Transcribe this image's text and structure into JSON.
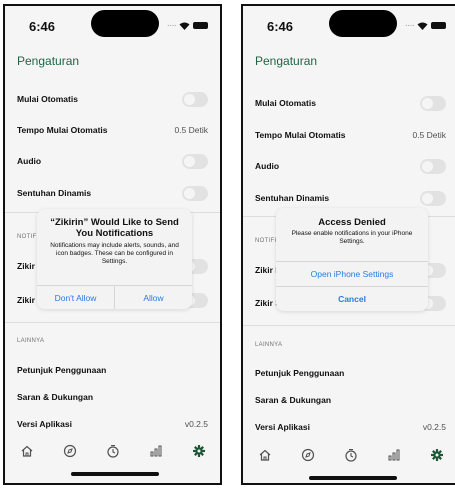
{
  "status_bar": {
    "time": "6:46"
  },
  "screen": {
    "title": "Pengaturan",
    "rows": {
      "auto_start": {
        "label": "Mulai Otomatis"
      },
      "auto_tempo": {
        "label": "Tempo Mulai Otomatis",
        "value": "0.5 Detik"
      },
      "audio": {
        "label": "Audio"
      },
      "haptics": {
        "label": "Sentuhan Dinamis"
      },
      "notif_row1": {
        "label": "Zikir P"
      },
      "notif_row2": {
        "label": "Zikir S"
      },
      "guide": {
        "label": "Petunjuk Penggunaan"
      },
      "support": {
        "label": "Saran & Dukungan"
      },
      "version": {
        "label": "Versi Aplikasi",
        "value": "v0.2.5"
      }
    },
    "sections": {
      "notifications": "NOTIFI",
      "others": "LAINNYA"
    },
    "tabs": [
      "home-icon",
      "compass-icon",
      "timer-icon",
      "stats-icon",
      "gear-icon"
    ]
  },
  "permission_dialog": {
    "title": "“Zikirin” Would Like to Send You Notifications",
    "message": "Notifications may include alerts, sounds, and icon badges. These can be configured in Settings.",
    "deny_label": "Don't Allow",
    "allow_label": "Allow"
  },
  "denied_dialog": {
    "title": "Access Denied",
    "message": "Please enable notifications in your iPhone Settings.",
    "open_label": "Open iPhone Settings",
    "cancel_label": "Cancel"
  },
  "colors": {
    "accent": "#1f6b47",
    "link": "#2a7ae0",
    "active_tab": "#1f5b3a"
  }
}
